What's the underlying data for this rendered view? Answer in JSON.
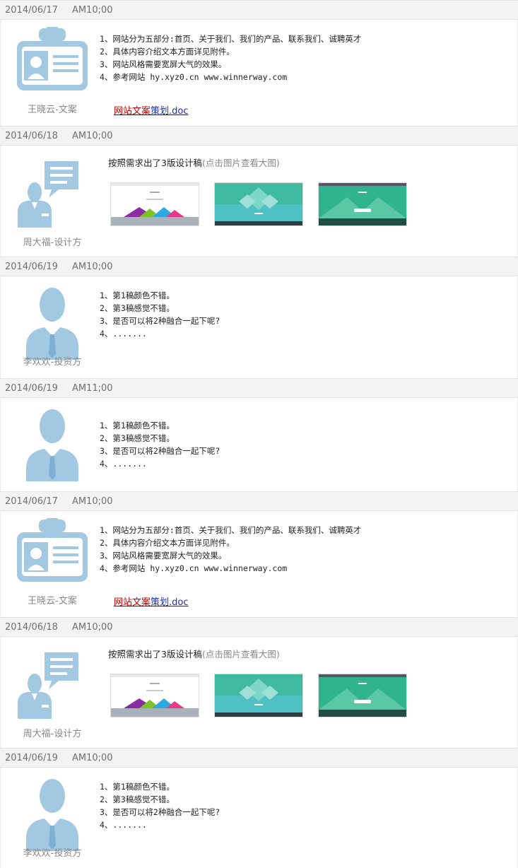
{
  "entries": [
    {
      "date": "2014/06/17",
      "time": "AM10;00",
      "author": "王晓云-文案",
      "avatar": "id-badge-avatar",
      "lines": [
        "1、网站分为五部分:首页、关于我们、我们的产品、联系我们、诚聘英才",
        "2、具体内容介绍文本方面详见附件。",
        "3、网站风格需要宽屏大气的效果。",
        "4、参考网站 hy.xyz0.cn www.winnerway.com"
      ],
      "attachment": {
        "part1": "网站文案",
        "part2": "策划.doc"
      }
    },
    {
      "date": "2014/06/18",
      "time": "AM10;00",
      "author": "周大福-设计方",
      "avatar": "designer-avatar",
      "intro": "按照需求出了3版设计稿",
      "hint": "(点击图片查看大图)",
      "thumbs": [
        "design-draft-1",
        "design-draft-2",
        "design-draft-3"
      ]
    },
    {
      "date": "2014/06/19",
      "time": "AM10;00",
      "author": "李欢欢-投资方",
      "avatar": "person-avatar",
      "lines": [
        "1、第1稿颜色不错。",
        "2、第3稿感觉不错。",
        "3、是否可以将2种融合一起下呢?",
        "4、......."
      ]
    },
    {
      "date": "2014/06/19",
      "time": "AM11;00",
      "author": "",
      "avatar": "person-avatar",
      "lines": [
        "1、第1稿颜色不错。",
        "2、第3稿感觉不错。",
        "3、是否可以将2种融合一起下呢?",
        "4、......."
      ]
    },
    {
      "date": "2014/06/17",
      "time": "AM10;00",
      "author": "王晓云-文案",
      "avatar": "id-badge-avatar",
      "lines": [
        "1、网站分为五部分:首页、关于我们、我们的产品、联系我们、诚聘英才",
        "2、具体内容介绍文本方面详见附件。",
        "3、网站风格需要宽屏大气的效果。",
        "4、参考网站 hy.xyz0.cn www.winnerway.com"
      ],
      "attachment": {
        "part1": "网站文案",
        "part2": "策划.doc"
      }
    },
    {
      "date": "2014/06/18",
      "time": "AM10;00",
      "author": "周大福-设计方",
      "avatar": "designer-avatar",
      "intro": "按照需求出了3版设计稿",
      "hint": "(点击图片查看大图)",
      "thumbs": [
        "design-draft-1",
        "design-draft-2",
        "design-draft-3"
      ]
    },
    {
      "date": "2014/06/19",
      "time": "AM10;00",
      "author": "李欢欢-投资方",
      "avatar": "person-avatar",
      "lines": [
        "1、第1稿颜色不错。",
        "2、第3稿感觉不错。",
        "3、是否可以将2种融合一起下呢?",
        "4、......."
      ]
    }
  ],
  "colors": {
    "avatar": "#a3c8e2",
    "avatar_dark": "#7fb0d3",
    "header_bg": "#f3f3f3",
    "link_red": "#c00000",
    "link_blue": "#1a2eb8",
    "thumb_teal": "#36b59b"
  }
}
